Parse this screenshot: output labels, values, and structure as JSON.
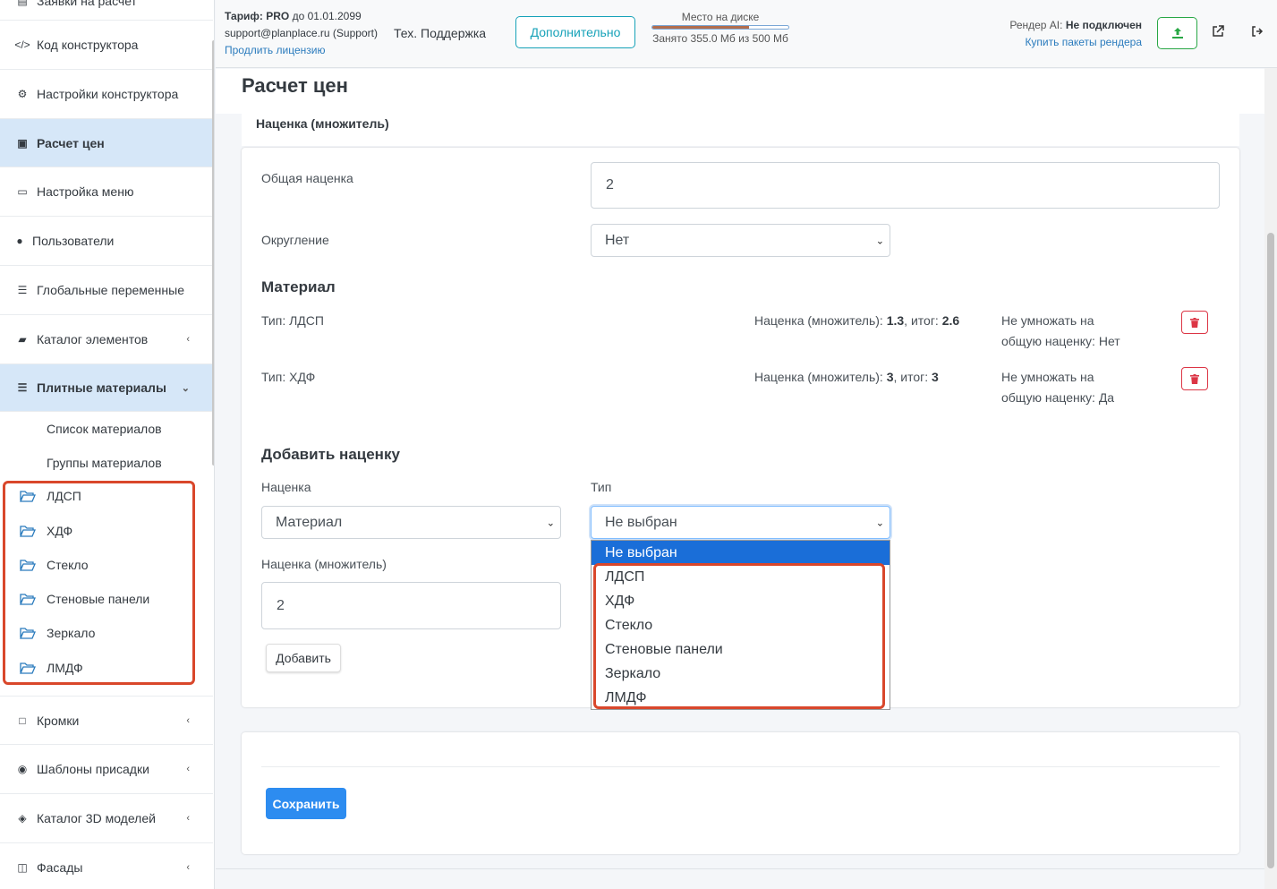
{
  "sidebar": {
    "cut_item": "Заявки на расчет",
    "items": [
      {
        "label": "Код конструктора",
        "icon": "code-icon"
      },
      {
        "label": "Настройки конструктора",
        "icon": "gears-icon"
      },
      {
        "label": "Расчет цен",
        "icon": "money-icon"
      },
      {
        "label": "Настройка меню",
        "icon": "monitor-icon"
      },
      {
        "label": "Пользователи",
        "icon": "user-icon"
      },
      {
        "label": "Глобальные переменные",
        "icon": "list-icon"
      },
      {
        "label": "Каталог элементов",
        "icon": "book-icon"
      },
      {
        "label": "Плитные материалы",
        "icon": "bars-icon"
      }
    ],
    "sub_items": [
      "Список материалов",
      "Группы материалов"
    ],
    "folders": [
      "ЛДСП",
      "ХДФ",
      "Стекло",
      "Стеновые панели",
      "Зеркало",
      "ЛМДФ"
    ],
    "bottom_items": [
      {
        "label": "Кромки",
        "icon": "square-icon"
      },
      {
        "label": "Шаблоны присадки",
        "icon": "dot-circle-icon"
      },
      {
        "label": "Каталог 3D моделей",
        "icon": "cube-icon"
      },
      {
        "label": "Фасады",
        "icon": "columns-icon"
      }
    ]
  },
  "topbar": {
    "tariff_label": "Тариф:",
    "tariff_name": "PRO",
    "tariff_until": "до 01.01.2099",
    "email": "support@planplace.ru (Support)",
    "extend_link": "Продлить лицензию",
    "support_label": "Тех. Поддержка",
    "extra_button": "Дополнительно",
    "disk_title": "Место на диске",
    "disk_used": "Занято 355.0 Мб из 500 Мб",
    "disk_fraction": 0.71,
    "render_label": "Рендер AI:",
    "render_status": "Не подключен",
    "render_buy": "Купить пакеты рендера"
  },
  "page": {
    "title": "Расчет цен",
    "section_label": "Наценка (множитель)"
  },
  "form": {
    "general_markup_label": "Общая наценка",
    "general_markup_value": "2",
    "rounding_label": "Округление",
    "rounding_value": "Нет",
    "material_heading": "Материал",
    "materials": [
      {
        "type": "Тип: ЛДСП",
        "markup_label": "Наценка (множитель):",
        "markup": "1.3",
        "total_label": ", итог:",
        "total": "2.6",
        "no_mult_1": "Не умножать на",
        "no_mult_2": "общую наценку: Нет"
      },
      {
        "type": "Тип: ХДФ",
        "markup_label": "Наценка (множитель):",
        "markup": "3",
        "total_label": ", итог:",
        "total": "3",
        "no_mult_1": "Не умножать на",
        "no_mult_2": "общую наценку: Да"
      }
    ],
    "add_heading": "Добавить наценку",
    "markup_label": "Наценка",
    "markup_select": "Материал",
    "type_label": "Тип",
    "type_select": "Не выбран",
    "multiplier_label": "Наценка (множитель)",
    "multiplier_value": "2",
    "add_button": "Добавить",
    "dropdown_options": [
      "Не выбран",
      "ЛДСП",
      "ХДФ",
      "Стекло",
      "Стеновые панели",
      "Зеркало",
      "ЛМДФ"
    ]
  },
  "save_button": "Сохранить",
  "colors": {
    "accent": "#2d8cf0",
    "highlight_box": "#d9472b",
    "active_nav": "#d6e7f8",
    "dropdown_selected": "#1a6ed8"
  }
}
